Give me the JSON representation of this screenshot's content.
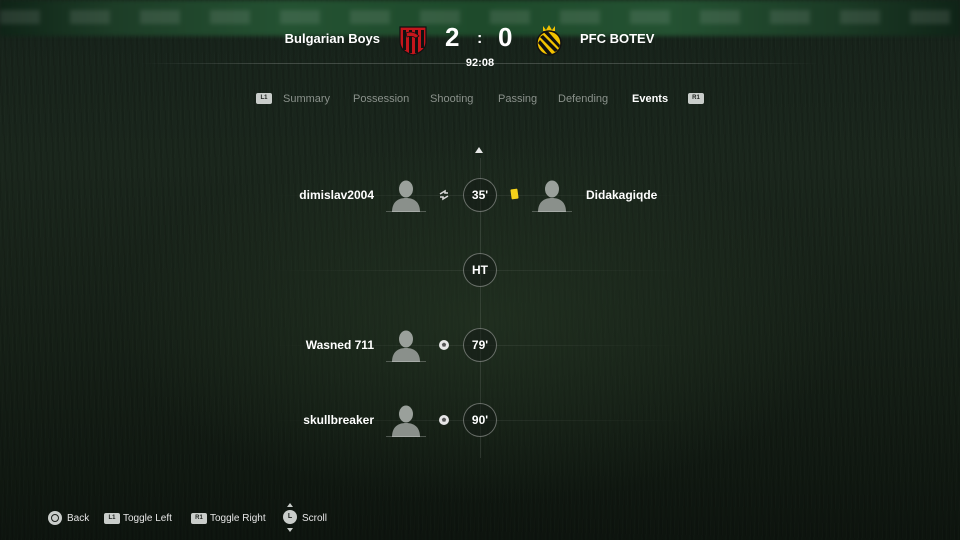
{
  "match": {
    "home_team": "Bulgarian Boys",
    "away_team": "PFC BOTEV",
    "home_score": "2",
    "away_score": "0",
    "separator": ":",
    "clock": "92:08"
  },
  "tabs": {
    "left_bumper": "L1",
    "right_bumper": "R1",
    "items": [
      "Summary",
      "Possession",
      "Shooting",
      "Passing",
      "Defending",
      "Events"
    ],
    "active": "Events"
  },
  "events": [
    {
      "minute": "35'",
      "home_player": "dimislav2004",
      "home_icon": "substitution-icon",
      "away_player": "Didakagiqde",
      "away_icon": "yellow-card-icon"
    },
    {
      "minute": "HT"
    },
    {
      "minute": "79'",
      "home_player": "Wasned 711",
      "home_icon": "goal-ball-icon"
    },
    {
      "minute": "90'",
      "home_player": "skullbreaker",
      "home_icon": "goal-ball-icon"
    }
  ],
  "footer": {
    "back": "Back",
    "toggle_left_badge": "L1",
    "toggle_left": "Toggle Left",
    "toggle_right_badge": "R1",
    "toggle_right": "Toggle Right",
    "scroll_badge": "L",
    "scroll": "Scroll"
  },
  "colors": {
    "home_crest_primary": "#c4161c",
    "home_crest_secondary": "#111111",
    "away_crest_primary": "#f2c200",
    "away_crest_secondary": "#111111",
    "yellow_card": "#f5d21a",
    "active_tab": "#ffffff",
    "inactive_tab": "#8a918b"
  }
}
